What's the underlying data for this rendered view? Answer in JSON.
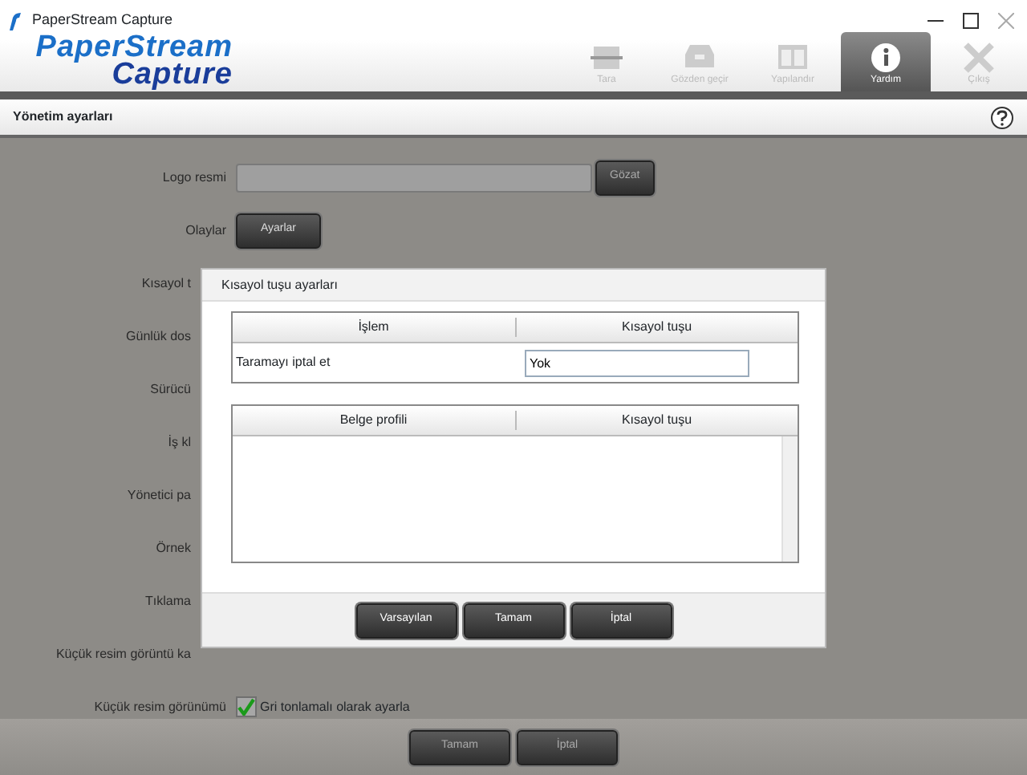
{
  "window": {
    "title": "PaperStream Capture"
  },
  "logo": {
    "line_1": "PaperStream",
    "line_2": "Capture"
  },
  "toolbar": [
    {
      "label": "Tara",
      "kind": "scan",
      "selected": false,
      "disabled": true
    },
    {
      "label": "Gözden geçir",
      "kind": "tray",
      "selected": false,
      "disabled": true
    },
    {
      "label": "Yapılandır",
      "kind": "layout",
      "selected": false,
      "disabled": true
    },
    {
      "label": "Yardım",
      "kind": "info",
      "selected": true,
      "disabled": false
    },
    {
      "label": "Çıkış",
      "kind": "exit",
      "selected": false,
      "disabled": true
    }
  ],
  "section": {
    "title": "Yönetim ayarları"
  },
  "form": [
    {
      "label": "Logo resmi",
      "kind": "file",
      "button": "Gözat"
    },
    {
      "label": "Olaylar",
      "kind": "button",
      "button": "Ayarlar"
    },
    {
      "label": "Kısayol t",
      "kind": "covered"
    },
    {
      "label": "Günlük dos",
      "kind": "covered"
    },
    {
      "label": "Sürücü",
      "kind": "covered"
    },
    {
      "label": "İş kl",
      "kind": "covered"
    },
    {
      "label": "Yönetici pa",
      "kind": "covered"
    },
    {
      "label": "Örnek",
      "kind": "covered"
    },
    {
      "label": "Tıklama",
      "kind": "covered"
    },
    {
      "label": "Küçük resim görüntü ka",
      "kind": "covered"
    },
    {
      "label": "Küçük resim görünümü",
      "kind": "checkbox",
      "text": "Gri tonlamalı olarak ayarla",
      "checked": true
    }
  ],
  "footer_buttons": [
    "Tamam",
    "İptal"
  ],
  "dialog": {
    "title": "Kısayol tuşu ayarları",
    "actions_table": {
      "columns": [
        "İşlem",
        "Kısayol tuşu"
      ],
      "rows": [
        {
          "action": "Taramayı iptal et",
          "shortcut": "Yok"
        }
      ]
    },
    "profiles_table": {
      "columns": [
        "Belge profili",
        "Kısayol tuşu"
      ]
    },
    "buttons": [
      "Varsayılan",
      "Tamam",
      "İptal"
    ]
  }
}
